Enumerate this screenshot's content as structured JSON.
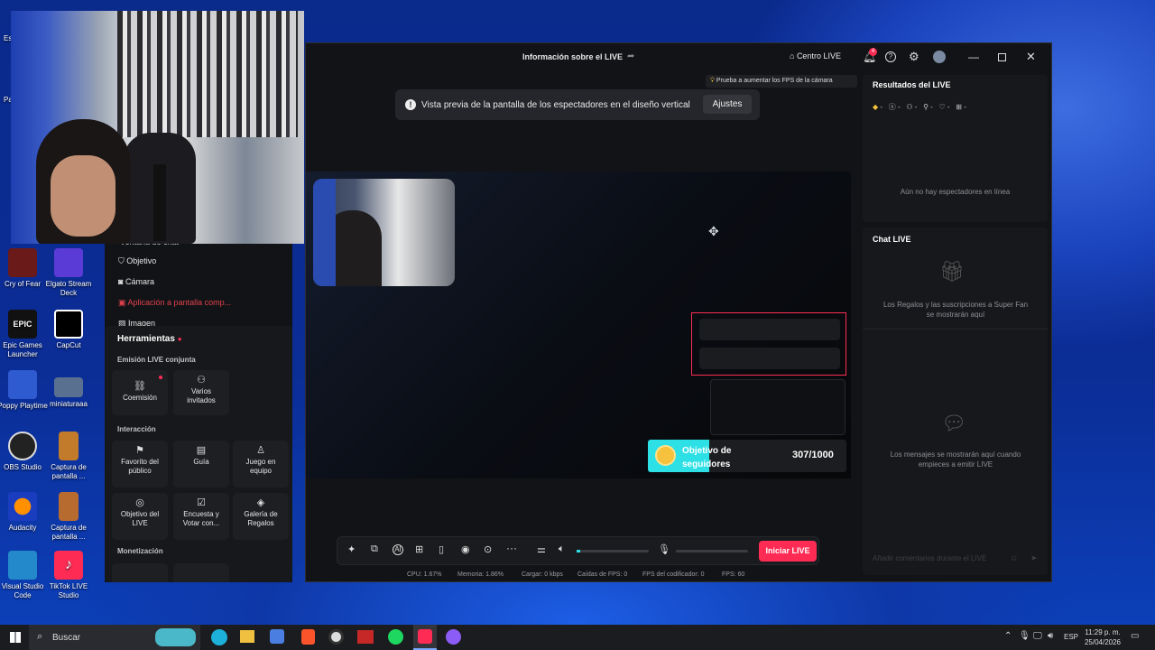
{
  "window": {
    "title": "Información sobre el LIVE",
    "centro_live": "Centro LIVE",
    "notif_count": "4",
    "fps_tip": "Prueba a aumentar los FPS de la cámara"
  },
  "notice": {
    "text": "Vista previa de la pantalla de los espectadores en el diseño vertical",
    "button": "Ajustes"
  },
  "goal": {
    "title": "Objetivo de seguidores",
    "progress": "307/1000"
  },
  "results": {
    "title": "Resultados del LIVE",
    "stats": [
      "-",
      "-",
      "-",
      "-",
      "-",
      "-"
    ],
    "empty": "Aún no hay espectadores en línea"
  },
  "chat": {
    "title": "Chat LIVE",
    "gifts_empty": "Los Regalos y las suscripciones a Super Fan se mostrarán aquí",
    "messages_empty": "Los mensajes se mostrarán aquí cuando empieces a emitir LIVE",
    "input_placeholder": "Añadir comentarios durante el LIVE"
  },
  "start_button": "Iniciar LIVE",
  "status": {
    "cpu": "CPU:  1.67%",
    "mem": "Memoria:  1.86%",
    "load": "Cargar:  0 kbps",
    "fps_drops": "Caídas de FPS:  0",
    "enc_fps": "FPS del codificador:  0",
    "fps": "FPS:  60"
  },
  "sources": {
    "partial": "Ventana de chat",
    "objetivo": "Objetivo",
    "camara": "Cámara",
    "app_share": "Aplicación a pantalla comp...",
    "imagen": "Imagen"
  },
  "tools": {
    "title": "Herramientas",
    "cohost_title": "Emisión LIVE conjunta",
    "cohost": [
      "Coemisión",
      "Varios invitados"
    ],
    "interaction_title": "Interacción",
    "interaction": [
      "Favorito del público",
      "Guía",
      "Juego en equipo",
      "Objetivo del LIVE",
      "Encuesta y Votar con...",
      "Galería de Regalos"
    ],
    "monetization_title": "Monetización"
  },
  "desktop": {
    "icons": [
      "Cry of Fear",
      "Elgato Stream Deck",
      "Epic Games Launcher",
      "CapCut",
      "Poppy Playtime",
      "miniaturaaa",
      "OBS Studio",
      "Captura de pantalla ...",
      "Audacity",
      "Captura de pantalla ...",
      "Visual Studio Code",
      "TikTok LIVE Studio"
    ],
    "partial_es": "Es",
    "partial_pa": "Pa"
  },
  "taskbar": {
    "search": "Buscar",
    "lang": "ESP",
    "time": "11:29 p. m.",
    "date": "25/04/2026"
  },
  "colors": {
    "accent": "#fe2c55",
    "goal": "#2ce0e6",
    "bg": "#121316"
  }
}
